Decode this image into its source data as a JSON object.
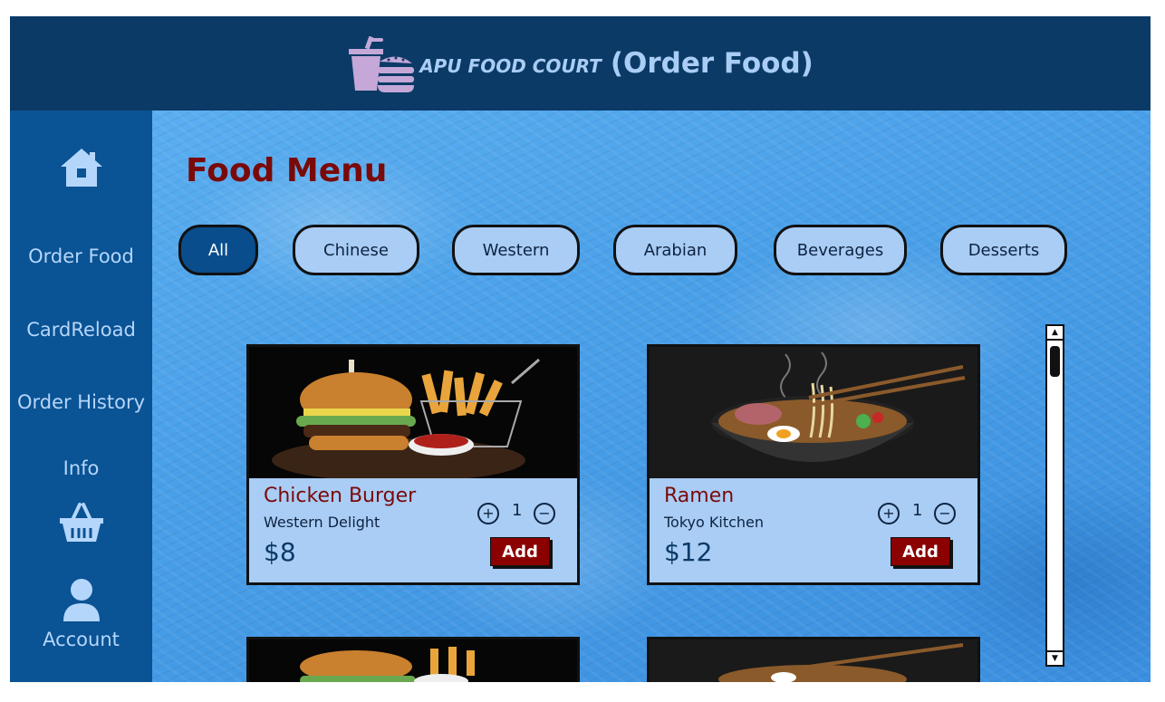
{
  "header": {
    "brand": "APU FOOD COURT",
    "subtitle": "(Order Food)",
    "logo_icon": "cup-and-burger-icon"
  },
  "sidebar": {
    "items": [
      {
        "label": "",
        "icon": "home-icon"
      },
      {
        "label": "Order Food"
      },
      {
        "label": "CardReload"
      },
      {
        "label": "Order History"
      },
      {
        "label": "Info"
      },
      {
        "label": "",
        "icon": "basket-icon"
      },
      {
        "label": "Account",
        "icon": "user-icon"
      }
    ]
  },
  "main": {
    "title": "Food Menu",
    "categories": [
      {
        "label": "All",
        "active": true
      },
      {
        "label": "Chinese"
      },
      {
        "label": "Western"
      },
      {
        "label": "Arabian"
      },
      {
        "label": "Beverages"
      },
      {
        "label": "Desserts"
      }
    ],
    "cards": [
      {
        "name": "Chicken Burger",
        "restaurant": "Western Delight",
        "price": "$8",
        "quantity": "1",
        "add_label": "Add",
        "image": "burger-and-fries-photo"
      },
      {
        "name": "Ramen",
        "restaurant": "Tokyo Kitchen",
        "price": "$12",
        "quantity": "1",
        "add_label": "Add",
        "image": "ramen-bowl-photo"
      }
    ]
  },
  "colors": {
    "header_bg": "#0b3a66",
    "sidebar_bg": "#0a5394",
    "accent_text": "#a9cdf5",
    "title_red": "#7a0a0a",
    "add_button": "#8b0000",
    "chip_active": "#0a4d8c"
  }
}
